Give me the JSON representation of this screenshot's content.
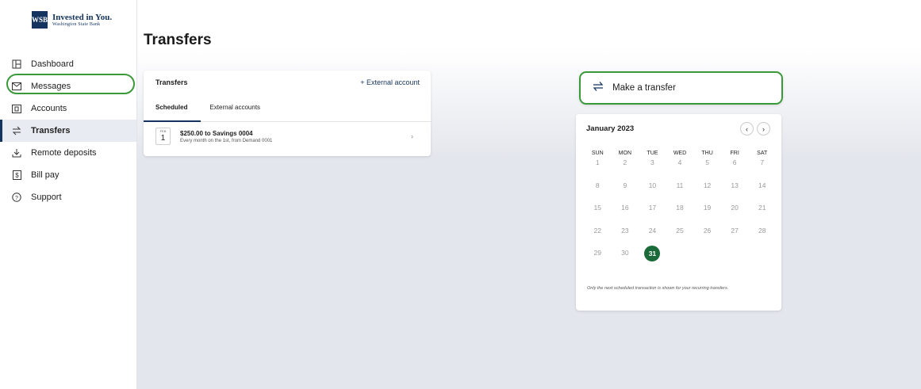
{
  "brand": {
    "logo_mark": "WSB",
    "line1": "Invested in You.",
    "line2": "Washington State Bank"
  },
  "sidebar": {
    "items": [
      {
        "label": "Dashboard",
        "icon": "dashboard-icon"
      },
      {
        "label": "Messages",
        "icon": "mail-icon"
      },
      {
        "label": "Accounts",
        "icon": "accounts-icon"
      },
      {
        "label": "Transfers",
        "icon": "transfer-icon",
        "active": true
      },
      {
        "label": "Remote deposits",
        "icon": "deposit-icon"
      },
      {
        "label": "Bill pay",
        "icon": "dollar-icon"
      },
      {
        "label": "Support",
        "icon": "help-icon"
      }
    ]
  },
  "page": {
    "title": "Transfers"
  },
  "transfers_card": {
    "title": "Transfers",
    "external_link": "+ External account",
    "tabs": [
      "Scheduled",
      "External accounts"
    ],
    "row": {
      "month": "FEB",
      "day": "1",
      "title": "$250.00 to Savings 0004",
      "subtitle": "Every month on the 1st, from Demand 0001"
    }
  },
  "make_transfer": {
    "label": "Make a transfer"
  },
  "calendar": {
    "month": "January 2023",
    "weekdays": [
      "SUN",
      "MON",
      "TUE",
      "WED",
      "THU",
      "FRI",
      "SAT"
    ],
    "days": [
      "1",
      "2",
      "3",
      "4",
      "5",
      "6",
      "7",
      "8",
      "9",
      "10",
      "11",
      "12",
      "13",
      "14",
      "15",
      "16",
      "17",
      "18",
      "19",
      "20",
      "21",
      "22",
      "23",
      "24",
      "25",
      "26",
      "27",
      "28",
      "29",
      "30",
      "31"
    ],
    "selected": "31",
    "note": "Only the next scheduled transaction is shown for your recurring transfers."
  },
  "colors": {
    "brand_navy": "#14345f",
    "highlight_green": "#3a9a3a",
    "selected_day": "#1b6b3a"
  }
}
